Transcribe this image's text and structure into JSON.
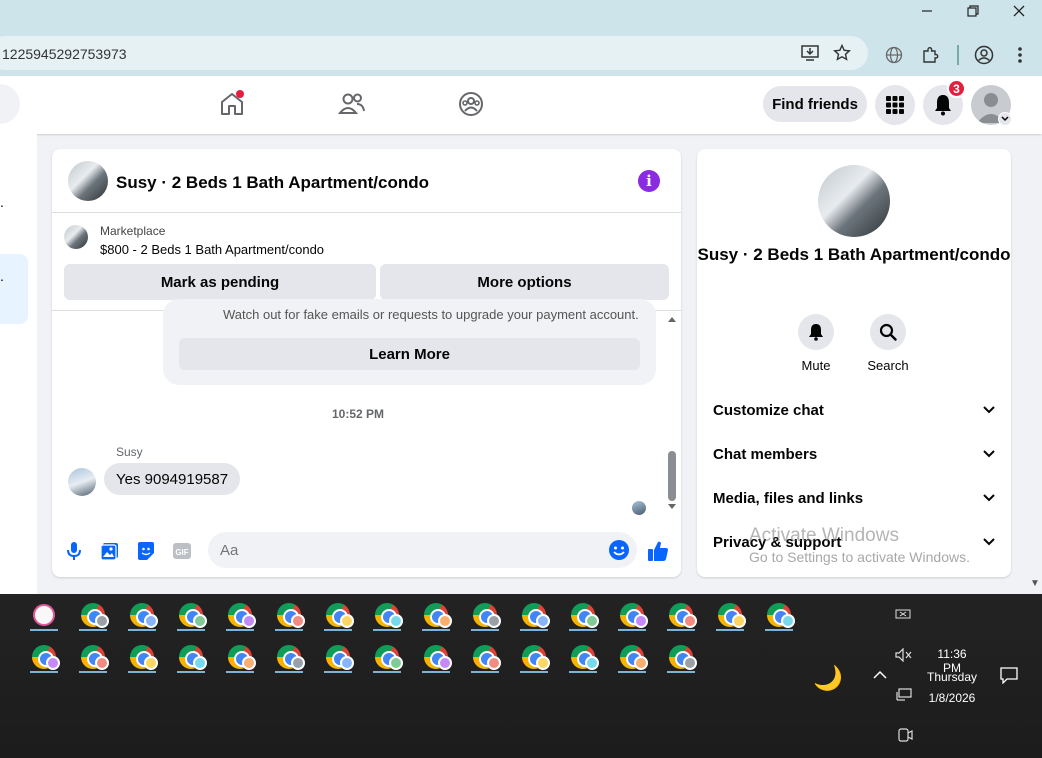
{
  "browser": {
    "url_fragment": "1225945292753973",
    "window_controls": [
      "minimize-icon",
      "restore-icon",
      "close-icon"
    ],
    "toolbar_icons": [
      "install-app-icon",
      "bookmark-star-icon",
      "translate-globe-icon",
      "extensions-puzzle-icon",
      "profile-icon",
      "kebab-menu-icon"
    ]
  },
  "fb_nav": {
    "find_friends_label": "Find friends",
    "notifications_count": "3",
    "accent": "#e41e3f"
  },
  "chat": {
    "title": "Susy · 2 Beds 1 Bath Apartment/condo",
    "marketplace_label": "Marketplace",
    "listing": "$800 - 2 Beds 1 Bath Apartment/condo",
    "mark_pending_label": "Mark as pending",
    "more_options_label": "More options",
    "notice_text": "Watch out for fake emails or requests to upgrade your payment account.",
    "learn_more_label": "Learn More",
    "timestamp": "10:52 PM",
    "sender_name": "Susy",
    "message": "Yes 9094919587",
    "composer_placeholder": "Aa",
    "accent": "#0866ff",
    "info_color": "#8a2be2"
  },
  "info_panel": {
    "name": "Susy · 2 Beds 1 Bath Apartment/condo",
    "actions": [
      {
        "label": "Mute",
        "icon": "bell-icon"
      },
      {
        "label": "Search",
        "icon": "search-icon"
      }
    ],
    "sections": [
      "Customize chat",
      "Chat members",
      "Media, files and links",
      "Privacy & support"
    ]
  },
  "watermark": {
    "line1": "Activate Windows",
    "line2": "Go to Settings to activate Windows."
  },
  "taskbar": {
    "time": "11:36 PM",
    "day": "Thursday",
    "date": "1/8/2026"
  }
}
